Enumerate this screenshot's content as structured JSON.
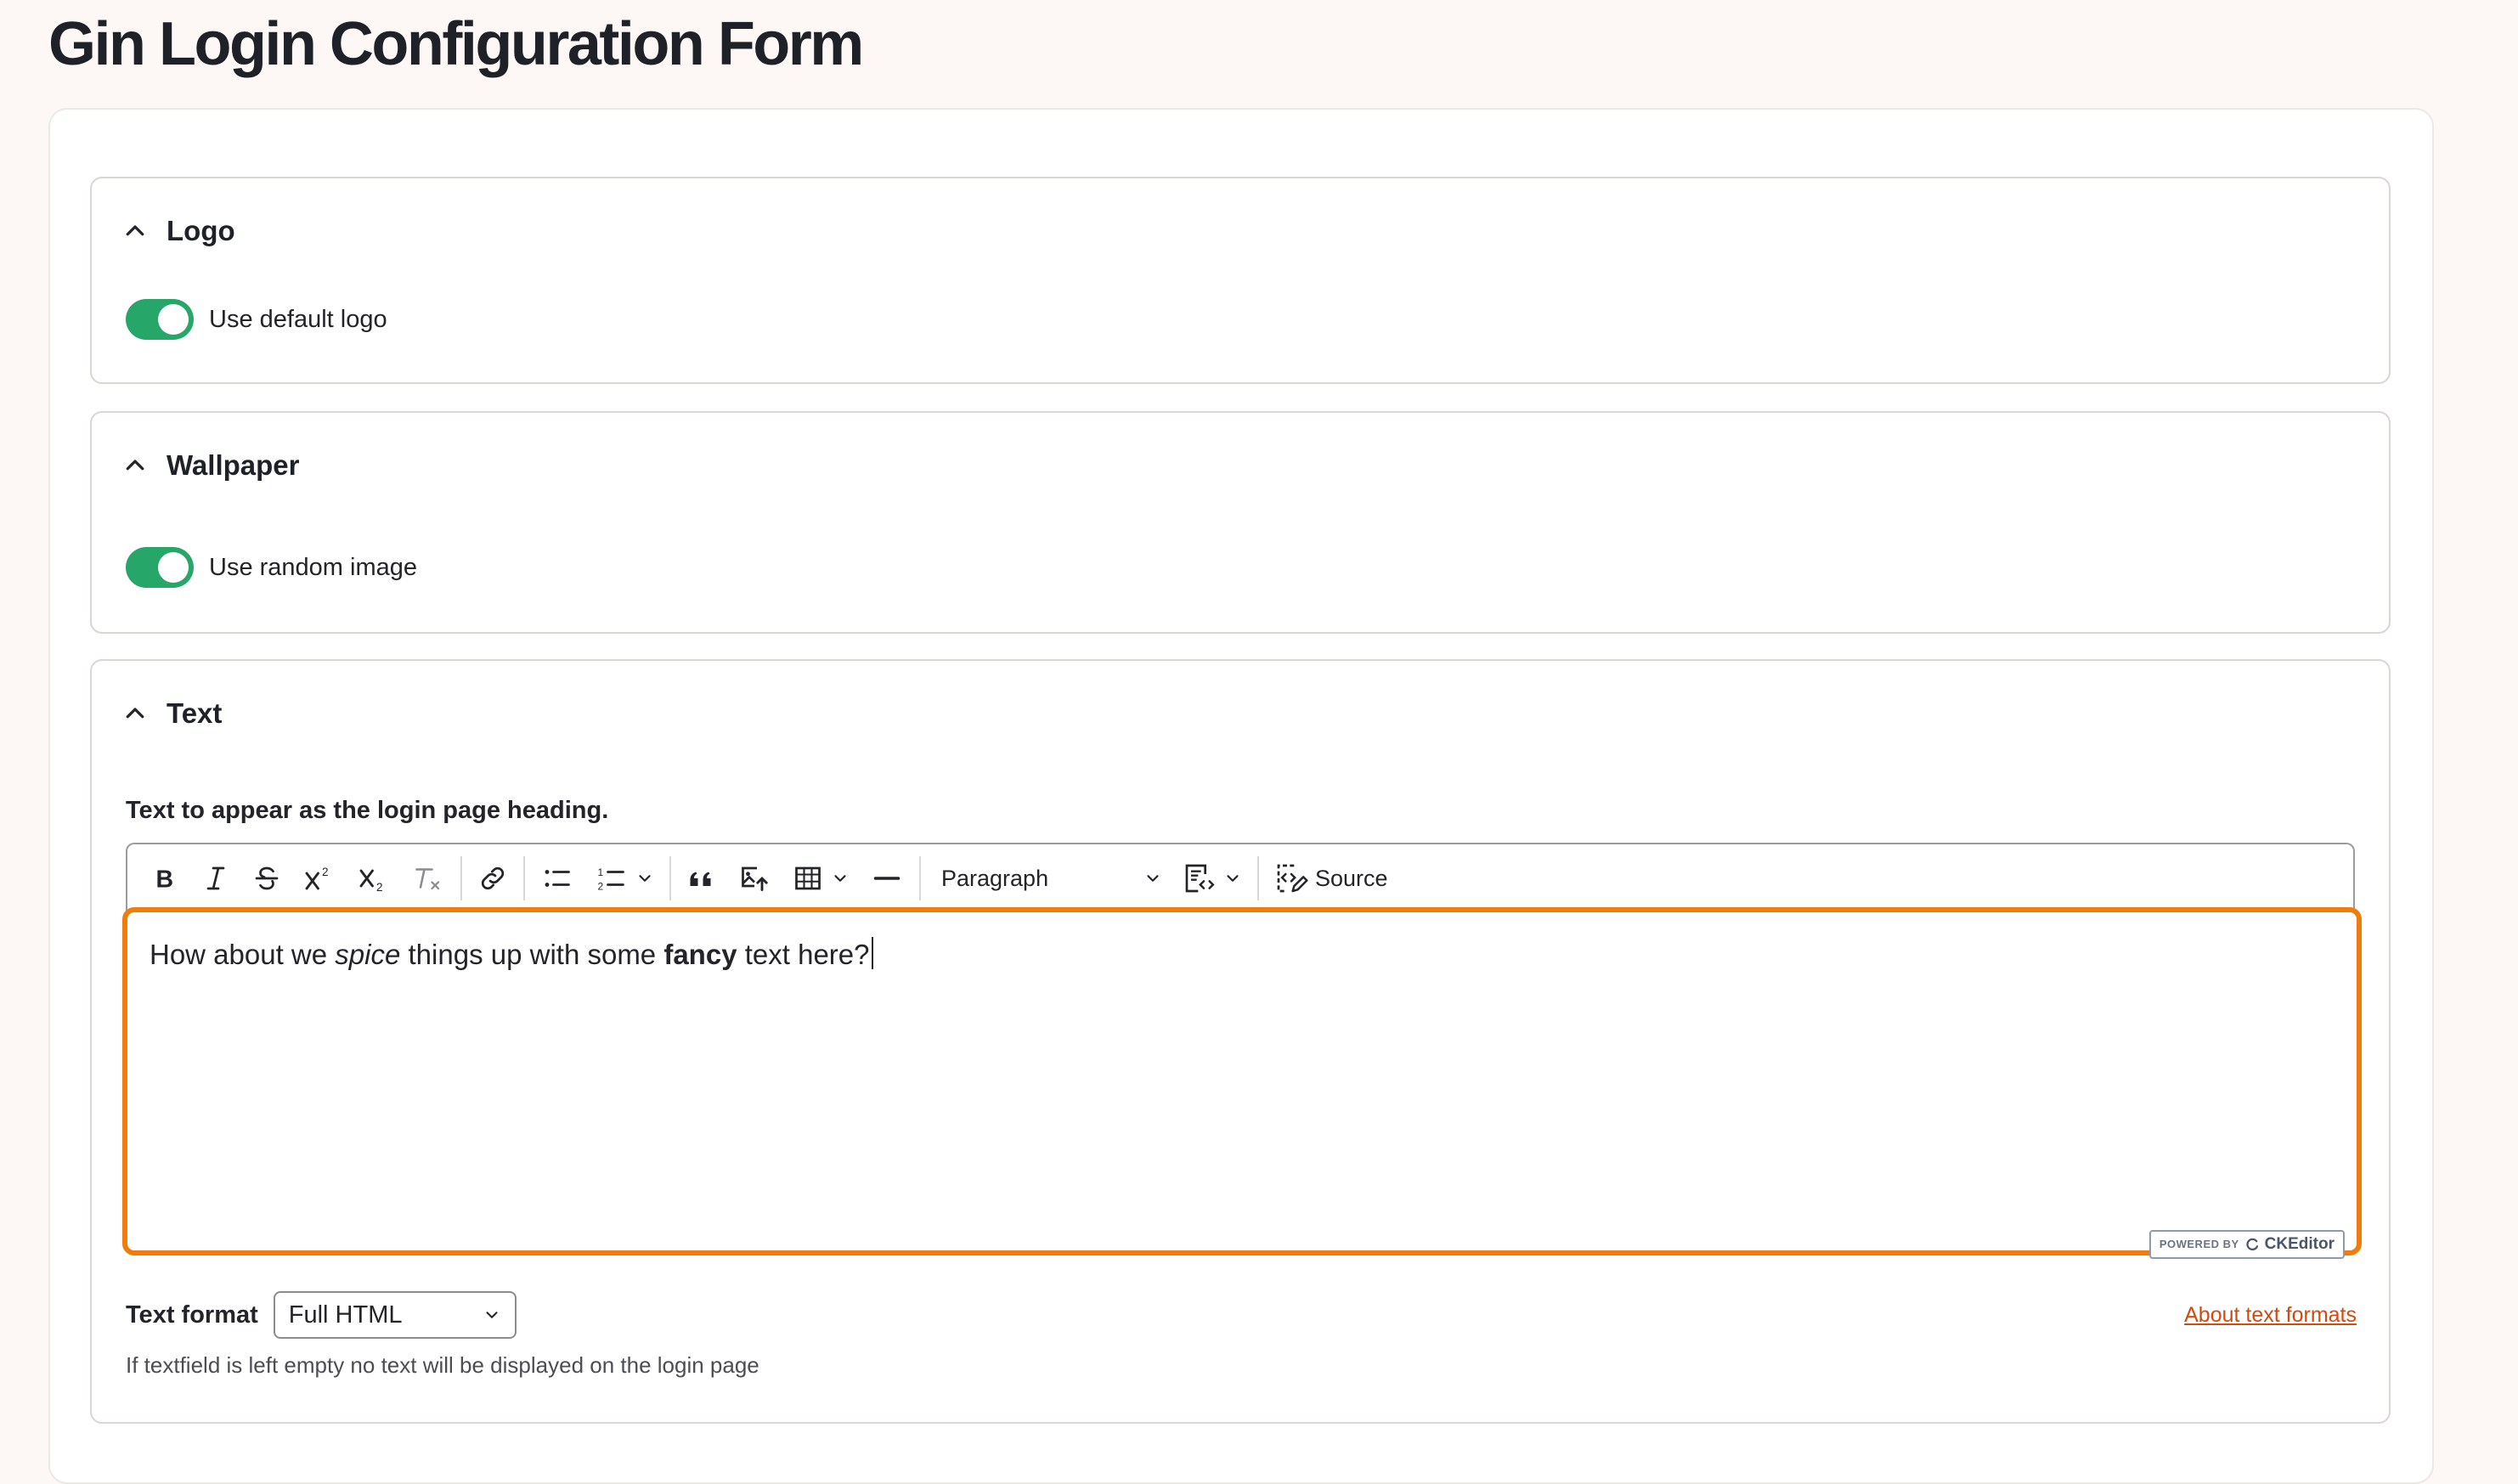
{
  "page": {
    "title": "Gin Login Configuration Form"
  },
  "sections": {
    "logo": {
      "title": "Logo",
      "toggle_label": "Use default logo",
      "toggle_on": true
    },
    "wallpaper": {
      "title": "Wallpaper",
      "toggle_label": "Use random image",
      "toggle_on": true
    },
    "text": {
      "title": "Text",
      "field_label": "Text to appear as the login page heading.",
      "toolbar": {
        "buttons": [
          "bold-icon",
          "italic-icon",
          "strikethrough-icon",
          "superscript-icon",
          "subscript-icon",
          "remove-format-icon",
          "link-icon",
          "bulleted-list-icon",
          "numbered-list-icon",
          "blockquote-icon",
          "image-upload-icon",
          "table-icon",
          "horizontal-line-icon",
          "code-block-icon",
          "source-icon"
        ],
        "heading_select": "Paragraph",
        "source_label": "Source"
      },
      "editor": {
        "part1": "How about we ",
        "italic": "spice",
        "part2": " things up with some ",
        "bold": "fancy",
        "part3": " text here?"
      },
      "powered_by": {
        "prefix": "POWERED BY",
        "brand": "CKEditor"
      },
      "format": {
        "label": "Text format",
        "selected": "Full HTML",
        "about_link": "About text formats",
        "help": "If textfield is left empty no text will be displayed on the login page"
      }
    }
  },
  "colors": {
    "toggle_on": "#26a769",
    "focus_border": "#f07c0e",
    "link": "#d34a0f",
    "page_bg": "#fdf8f5"
  }
}
